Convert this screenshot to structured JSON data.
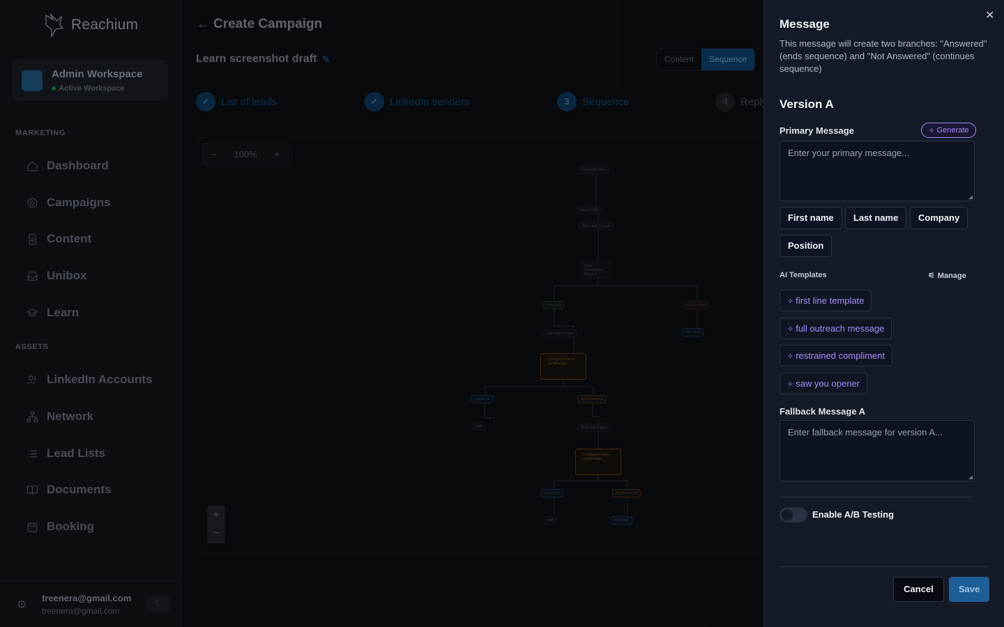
{
  "brand": {
    "name": "Reachium"
  },
  "workspace": {
    "name": "Admin Workspace",
    "status": "Active Workspace"
  },
  "sidebar": {
    "marketing_label": "MARKETING",
    "marketing_items": [
      {
        "label": "Dashboard",
        "icon": "home-icon"
      },
      {
        "label": "Campaigns",
        "icon": "target-icon"
      },
      {
        "label": "Content",
        "icon": "document-icon"
      },
      {
        "label": "Unibox",
        "icon": "inbox-icon"
      },
      {
        "label": "Learn",
        "icon": "graduation-cap-icon"
      }
    ],
    "assets_label": "ASSETS",
    "assets_items": [
      {
        "label": "LinkedIn Accounts",
        "icon": "users-icon"
      },
      {
        "label": "Network",
        "icon": "network-icon"
      },
      {
        "label": "Lead Lists",
        "icon": "list-icon"
      },
      {
        "label": "Documents",
        "icon": "book-icon"
      },
      {
        "label": "Booking",
        "icon": "calendar-icon"
      }
    ]
  },
  "user": {
    "email": "treenera@gmail.com",
    "sub": "treenera@gmail.com"
  },
  "header": {
    "title": "Create Campaign",
    "draft_name": "Learn screenshot draft"
  },
  "view_toggle": {
    "content": "Content",
    "sequence": "Sequence",
    "active": "Sequence"
  },
  "steps": [
    {
      "marker": "✓",
      "label": "List of leads"
    },
    {
      "marker": "✓",
      "label": "LinkedIn senders"
    },
    {
      "marker": "3",
      "label": "Sequence"
    },
    {
      "marker": "4",
      "label": "Reply"
    }
  ],
  "canvas": {
    "zoom": "100%",
    "zoom_minus": "−",
    "zoom_plus": "+"
  },
  "flow": {
    "start": "Campaign Start",
    "view_profile": "View Profile",
    "wait1": "Then wait  3  hours",
    "connect": "Send Connection Request",
    "accepted": "Accepted",
    "not_accepted": "Not Accepted",
    "add_step": "Add Step",
    "wait2": "Then wait  3  hours",
    "followup": "Configure Follow-up Message",
    "answered": "Answered",
    "not_answered": "Not Answered",
    "end": "end",
    "wait3": "Then wait  3  days"
  },
  "panel": {
    "title": "Message",
    "description": "This message will create two branches: \"Answered\" (ends sequence) and \"Not Answered\" (continues sequence)",
    "version_title": "Version A",
    "primary_label": "Primary Message",
    "generate_label": "Generate",
    "primary_placeholder": "Enter your primary message...",
    "variables": [
      "First name",
      "Last name",
      "Company",
      "Position"
    ],
    "ai_templates_label": "AI Templates",
    "manage_label": "Manage",
    "ai_templates": [
      "first line template",
      "full outreach message",
      "restrained compliment",
      "saw you opener"
    ],
    "fallback_label": "Fallback Message A",
    "fallback_placeholder": "Enter fallback message for version A...",
    "ab_label": "Enable A/B Testing",
    "ab_enabled": false,
    "cancel_label": "Cancel",
    "save_label": "Save"
  },
  "colors": {
    "accent": "#1f5d96",
    "ai_purple": "#a78bfa",
    "panel_bg": "#141a26"
  }
}
